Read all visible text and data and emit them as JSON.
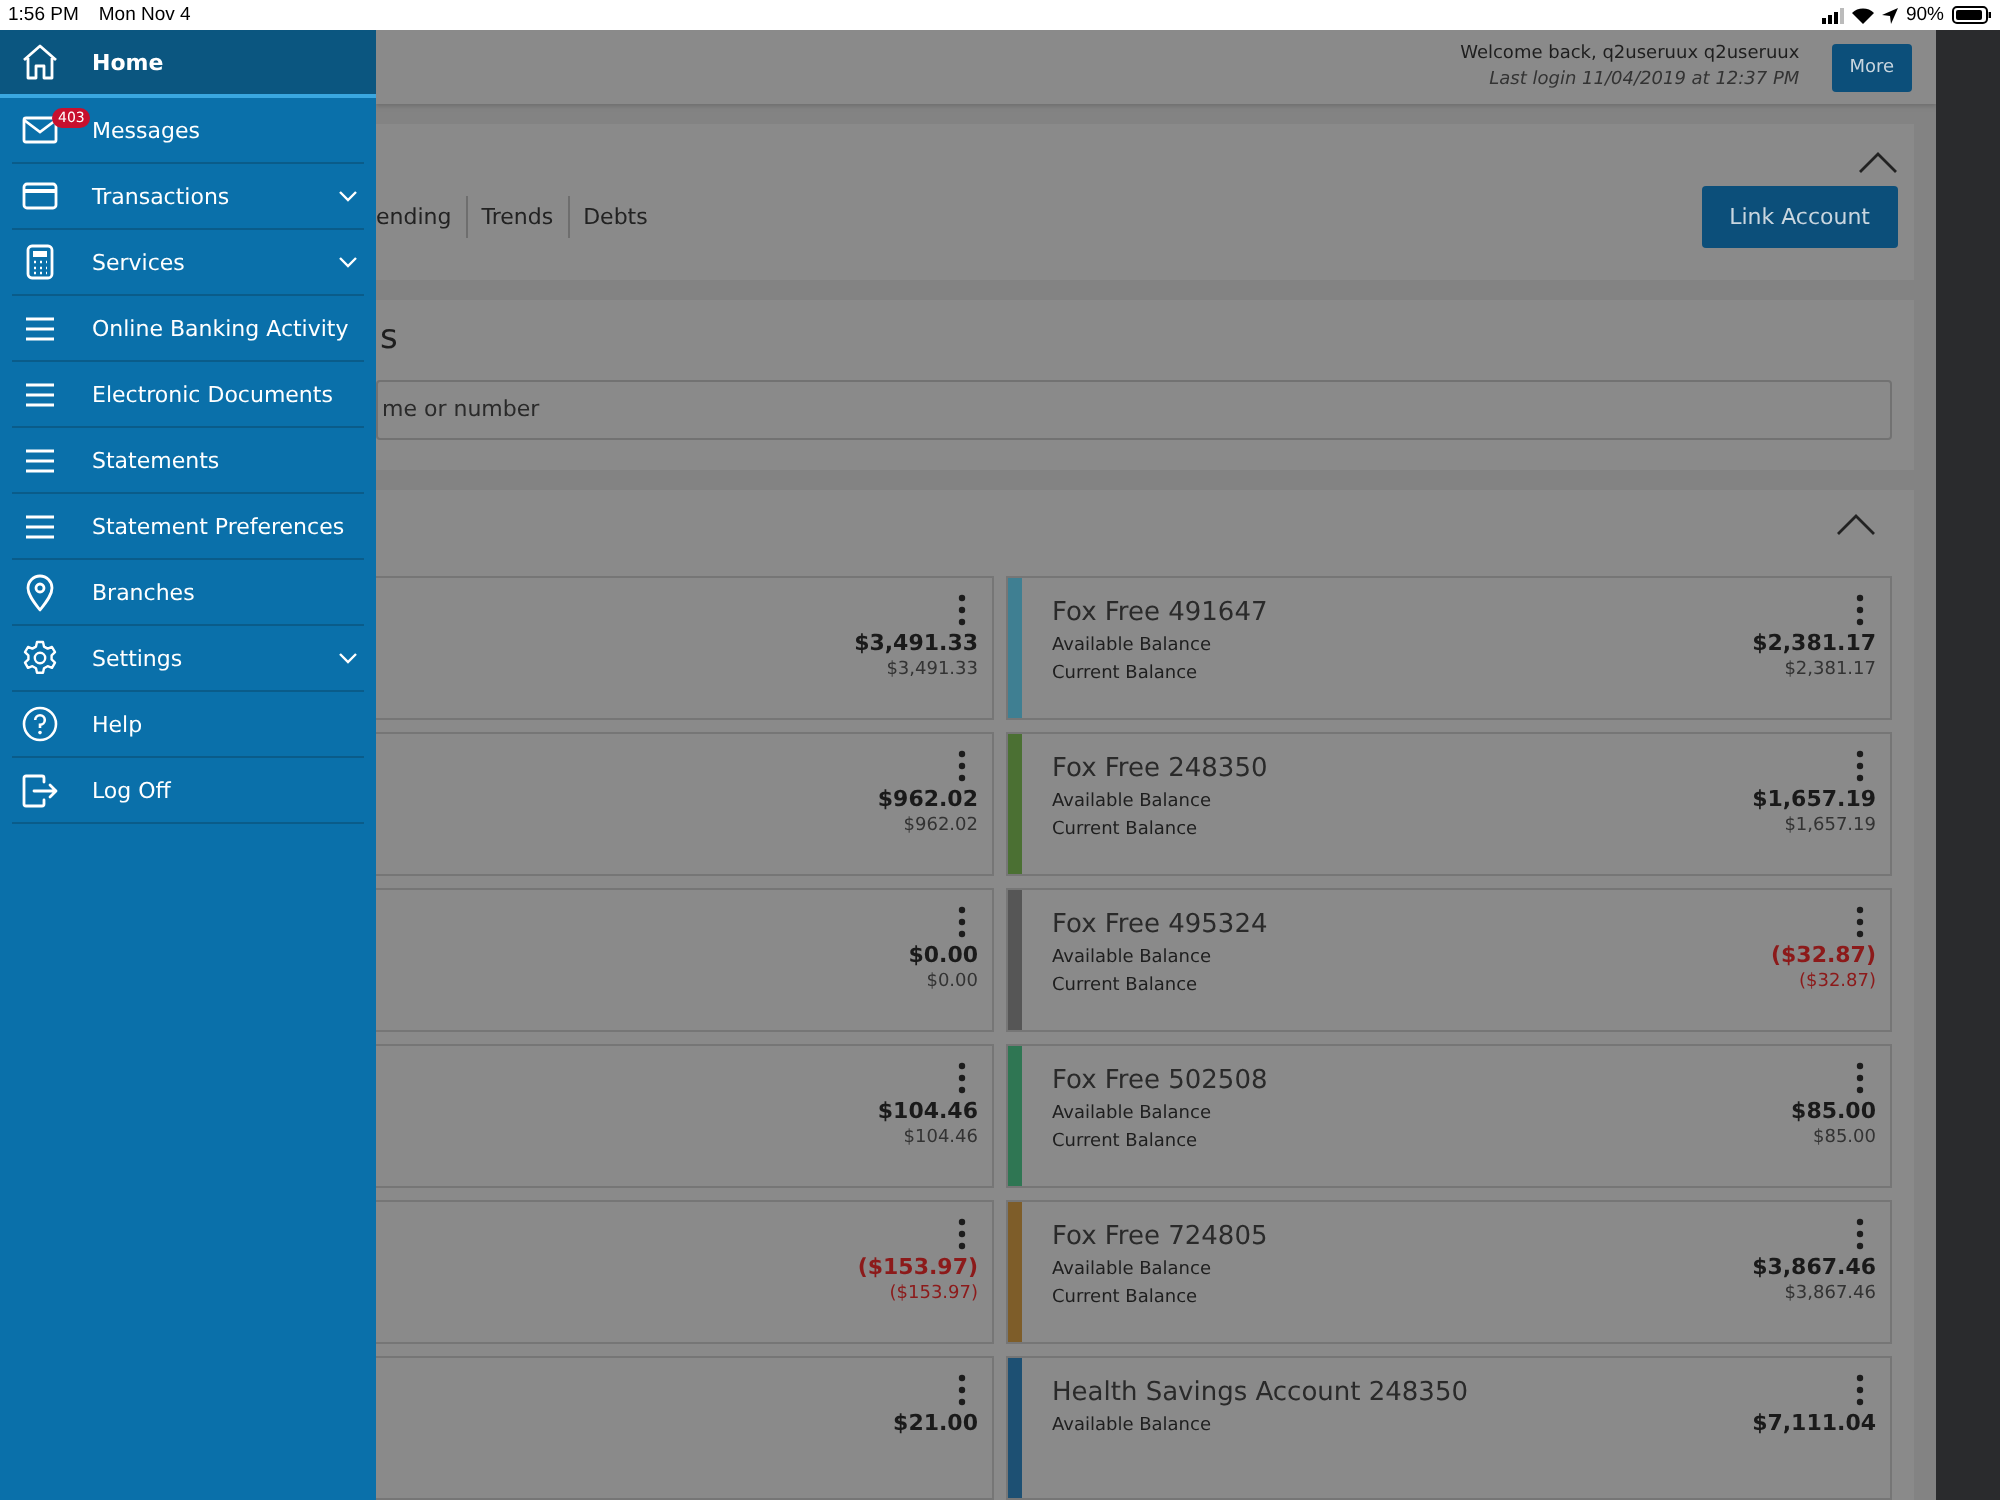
{
  "status_bar": {
    "time": "1:56 PM",
    "date": "Mon Nov 4",
    "battery": "90%"
  },
  "sidebar": {
    "items": [
      {
        "kind": "home",
        "label": "Home",
        "selected": true,
        "expandable": false
      },
      {
        "kind": "mail",
        "label": "Messages",
        "selected": false,
        "expandable": false,
        "badge": "403"
      },
      {
        "kind": "card",
        "label": "Transactions",
        "selected": false,
        "expandable": true
      },
      {
        "kind": "calculator",
        "label": "Services",
        "selected": false,
        "expandable": true
      },
      {
        "kind": "list",
        "label": "Online Banking Activity",
        "selected": false,
        "expandable": false
      },
      {
        "kind": "list",
        "label": "Electronic Documents",
        "selected": false,
        "expandable": false
      },
      {
        "kind": "list",
        "label": "Statements",
        "selected": false,
        "expandable": false
      },
      {
        "kind": "list",
        "label": "Statement Preferences",
        "selected": false,
        "expandable": false
      },
      {
        "kind": "pin",
        "label": "Branches",
        "selected": false,
        "expandable": false
      },
      {
        "kind": "gear",
        "label": "Settings",
        "selected": false,
        "expandable": true
      },
      {
        "kind": "help",
        "label": "Help",
        "selected": false,
        "expandable": false
      },
      {
        "kind": "logoff",
        "label": "Log Off",
        "selected": false,
        "expandable": false
      }
    ]
  },
  "header": {
    "welcome": "Welcome back, q2useruux q2useruux",
    "last_login": "Last login 11/04/2019 at 12:37 PM",
    "more_button": "More"
  },
  "overview": {
    "tabs": [
      "ending",
      "Trends",
      "Debts"
    ],
    "link_button": "Link Account"
  },
  "search": {
    "heading": "s",
    "placeholder": "me or number"
  },
  "accounts": [
    {
      "left": {
        "available": "$3,491.33",
        "current": "$3,491.33",
        "negative": false
      },
      "right": {
        "name": "Fox Free 491647",
        "color": "#3f7f92",
        "available_label": "Available Balance",
        "current_label": "Current Balance",
        "available": "$2,381.17",
        "current": "$2,381.17",
        "negative": false
      }
    },
    {
      "left": {
        "available": "$962.02",
        "current": "$962.02",
        "negative": false
      },
      "right": {
        "name": "Fox Free 248350",
        "color": "#4b7033",
        "available_label": "Available Balance",
        "current_label": "Current Balance",
        "available": "$1,657.19",
        "current": "$1,657.19",
        "negative": false
      }
    },
    {
      "left": {
        "available": "$0.00",
        "current": "$0.00",
        "negative": false
      },
      "right": {
        "name": "Fox Free 495324",
        "color": "#565656",
        "available_label": "Available Balance",
        "current_label": "Current Balance",
        "available": "($32.87)",
        "current": "($32.87)",
        "negative": true
      }
    },
    {
      "left": {
        "available": "$104.46",
        "current": "$104.46",
        "negative": false
      },
      "right": {
        "name": "Fox Free 502508",
        "color": "#2f7653",
        "available_label": "Available Balance",
        "current_label": "Current Balance",
        "available": "$85.00",
        "current": "$85.00",
        "negative": false
      }
    },
    {
      "left": {
        "available": "($153.97)",
        "current": "($153.97)",
        "negative": true
      },
      "right": {
        "name": "Fox Free 724805",
        "color": "#7e5d29",
        "available_label": "Available Balance",
        "current_label": "Current Balance",
        "available": "$3,867.46",
        "current": "$3,867.46",
        "negative": false
      }
    },
    {
      "left": {
        "available": "$21.00",
        "negative": false
      },
      "right": {
        "name": "Health Savings Account 248350",
        "color": "#1d5073",
        "available_label": "Available Balance",
        "available": "$7,111.04",
        "negative": false
      }
    }
  ]
}
